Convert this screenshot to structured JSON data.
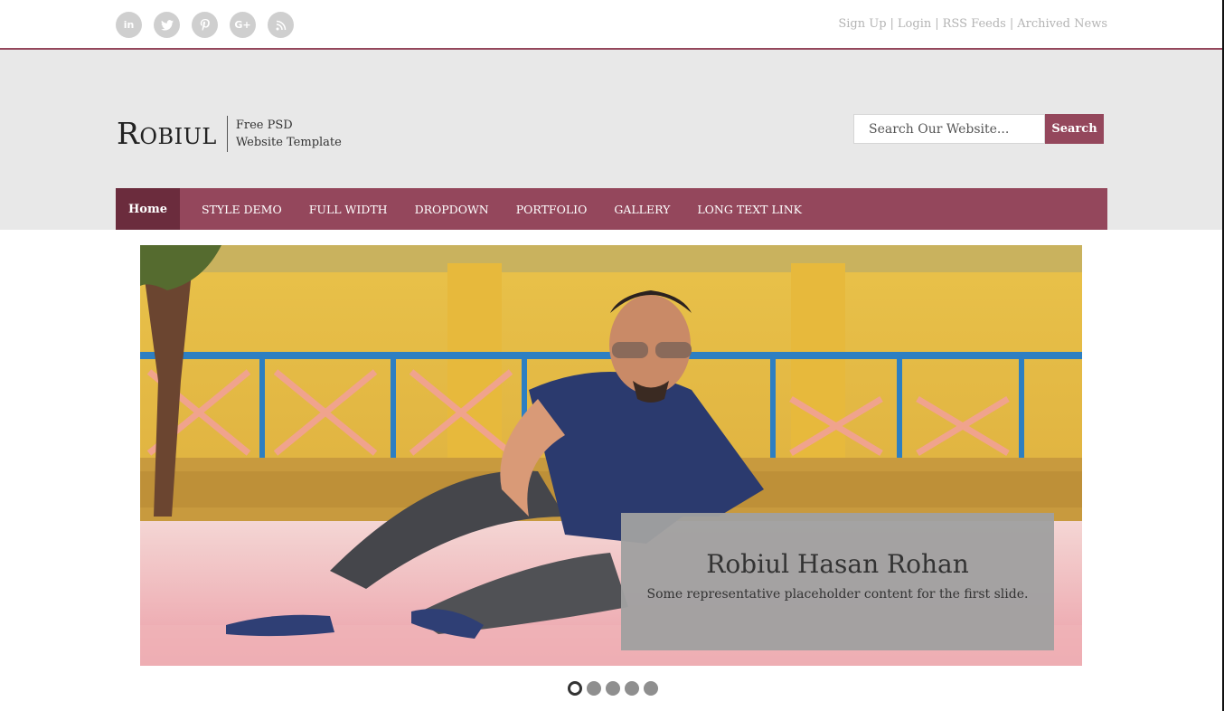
{
  "social": [
    {
      "icon": "linkedin-icon",
      "glyph": "in"
    },
    {
      "icon": "twitter-icon",
      "glyph": "t"
    },
    {
      "icon": "pinterest-icon",
      "glyph": "p"
    },
    {
      "icon": "google-plus-icon",
      "glyph": "G+"
    },
    {
      "icon": "rss-icon",
      "glyph": "≡"
    }
  ],
  "toplinks": {
    "signup": "Sign Up",
    "login": "Login",
    "rss": "RSS Feeds",
    "archived": "Archived News",
    "separator": "|"
  },
  "logo": {
    "first": "R",
    "rest": "OBIUL",
    "tag_line1": "Free PSD",
    "tag_line2": "Website Template"
  },
  "search": {
    "placeholder": "Search Our Website...",
    "button": "Search"
  },
  "nav": {
    "home": "Home",
    "style_demo": "STYLE DEMO",
    "full_width": "FULL WIDTH",
    "dropdown": "DROPDOWN",
    "portfolio": "PORTFOLIO",
    "gallery": "GALLERY",
    "long_text": "LONG TEXT LINK"
  },
  "slider": {
    "title": "Robiul Hasan Rohan",
    "text": "Some representative placeholder content for the first slide.",
    "slide_count": 5,
    "active_slide": 1
  },
  "colors": {
    "accent": "#94475c",
    "accent_dark": "#6b2c3d",
    "header_bg": "#e8e8e8"
  }
}
